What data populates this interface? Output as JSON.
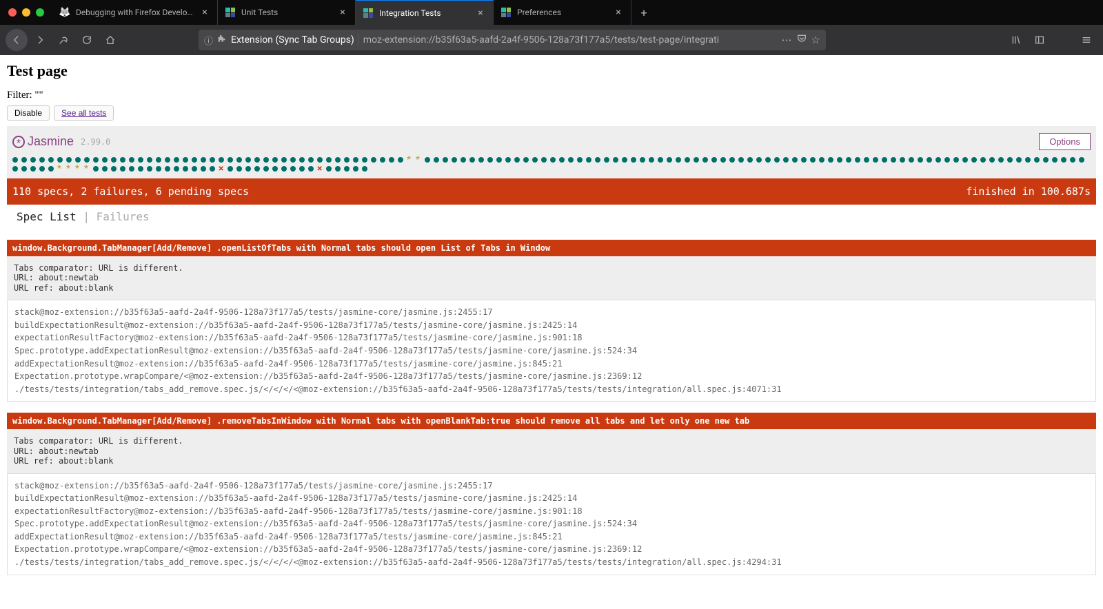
{
  "tabs": [
    {
      "label": "Debugging with Firefox Developer T",
      "favicon": "generic"
    },
    {
      "label": "Unit Tests",
      "favicon": "ext"
    },
    {
      "label": "Integration Tests",
      "favicon": "ext",
      "active": true
    },
    {
      "label": "Preferences",
      "favicon": "ext"
    }
  ],
  "urlbar": {
    "extension_label": "Extension (Sync Tab Groups)",
    "url": "moz-extension://b35f63a5-aafd-2a4f-9506-128a73f177a5/tests/test-page/integrati"
  },
  "page": {
    "title": "Test page",
    "filter_label": "Filter: \"\"",
    "disable_btn": "Disable",
    "see_all_btn": "See all tests"
  },
  "jasmine": {
    "name": "Jasmine",
    "version": "2.99.0",
    "options_btn": "Options"
  },
  "dots": [
    "p",
    "p",
    "p",
    "p",
    "p",
    "p",
    "p",
    "p",
    "p",
    "p",
    "p",
    "p",
    "p",
    "p",
    "p",
    "p",
    "p",
    "p",
    "p",
    "p",
    "p",
    "p",
    "p",
    "p",
    "p",
    "p",
    "p",
    "p",
    "p",
    "p",
    "p",
    "p",
    "p",
    "p",
    "p",
    "p",
    "p",
    "p",
    "p",
    "p",
    "p",
    "p",
    "p",
    "p",
    "pe",
    "pe",
    "p",
    "p",
    "p",
    "p",
    "p",
    "p",
    "p",
    "p",
    "p",
    "p",
    "p",
    "p",
    "p",
    "p",
    "p",
    "p",
    "p",
    "p",
    "p",
    "p",
    "p",
    "p",
    "p",
    "p",
    "p",
    "p",
    "p",
    "p",
    "p",
    "p",
    "p",
    "p",
    "p",
    "p",
    "p",
    "p",
    "p",
    "p",
    "p",
    "p",
    "p",
    "p",
    "p",
    "p",
    "p",
    "p",
    "p",
    "p",
    "p",
    "p",
    "p",
    "p",
    "p",
    "p",
    "p",
    "p",
    "p",
    "p",
    "p",
    "p",
    "p",
    "p",
    "p",
    "p",
    "p",
    "p",
    "p",
    "p",
    "p",
    "p",
    "p",
    "p",
    "p",
    "p",
    "p",
    "p",
    "p",
    "p",
    "p",
    "pe",
    "pe",
    "pe",
    "pe",
    "p",
    "p",
    "p",
    "p",
    "p",
    "p",
    "p",
    "p",
    "p",
    "p",
    "p",
    "p",
    "p",
    "p",
    "f",
    "p",
    "p",
    "p",
    "p",
    "p",
    "p",
    "p",
    "p",
    "p",
    "p",
    "f",
    "p",
    "p",
    "p",
    "p",
    "p"
  ],
  "summary": {
    "left": "110 specs, 2 failures, 6 pending specs",
    "right": "finished in 100.687s"
  },
  "speclist": {
    "active": "Spec List",
    "sep": " | ",
    "inactive": "Failures"
  },
  "failures": [
    {
      "title": "window.Background.TabManager[Add/Remove] .openListOfTabs with Normal tabs should open List of Tabs in Window",
      "error": "Tabs comparator: URL is different.\nURL: about:newtab\nURL ref: about:blank",
      "stack": "stack@moz-extension://b35f63a5-aafd-2a4f-9506-128a73f177a5/tests/jasmine-core/jasmine.js:2455:17\nbuildExpectationResult@moz-extension://b35f63a5-aafd-2a4f-9506-128a73f177a5/tests/jasmine-core/jasmine.js:2425:14\nexpectationResultFactory@moz-extension://b35f63a5-aafd-2a4f-9506-128a73f177a5/tests/jasmine-core/jasmine.js:901:18\nSpec.prototype.addExpectationResult@moz-extension://b35f63a5-aafd-2a4f-9506-128a73f177a5/tests/jasmine-core/jasmine.js:524:34\naddExpectationResult@moz-extension://b35f63a5-aafd-2a4f-9506-128a73f177a5/tests/jasmine-core/jasmine.js:845:21\nExpectation.prototype.wrapCompare/<@moz-extension://b35f63a5-aafd-2a4f-9506-128a73f177a5/tests/jasmine-core/jasmine.js:2369:12\n./tests/tests/integration/tabs_add_remove.spec.js/</</</<@moz-extension://b35f63a5-aafd-2a4f-9506-128a73f177a5/tests/tests/integration/all.spec.js:4071:31"
    },
    {
      "title": "window.Background.TabManager[Add/Remove] .removeTabsInWindow with Normal tabs with openBlankTab:true should remove all tabs and let only one new tab",
      "error": "Tabs comparator: URL is different.\nURL: about:newtab\nURL ref: about:blank",
      "stack": "stack@moz-extension://b35f63a5-aafd-2a4f-9506-128a73f177a5/tests/jasmine-core/jasmine.js:2455:17\nbuildExpectationResult@moz-extension://b35f63a5-aafd-2a4f-9506-128a73f177a5/tests/jasmine-core/jasmine.js:2425:14\nexpectationResultFactory@moz-extension://b35f63a5-aafd-2a4f-9506-128a73f177a5/tests/jasmine-core/jasmine.js:901:18\nSpec.prototype.addExpectationResult@moz-extension://b35f63a5-aafd-2a4f-9506-128a73f177a5/tests/jasmine-core/jasmine.js:524:34\naddExpectationResult@moz-extension://b35f63a5-aafd-2a4f-9506-128a73f177a5/tests/jasmine-core/jasmine.js:845:21\nExpectation.prototype.wrapCompare/<@moz-extension://b35f63a5-aafd-2a4f-9506-128a73f177a5/tests/jasmine-core/jasmine.js:2369:12\n./tests/tests/integration/tabs_add_remove.spec.js/</</</<@moz-extension://b35f63a5-aafd-2a4f-9506-128a73f177a5/tests/tests/integration/all.spec.js:4294:31"
    }
  ]
}
